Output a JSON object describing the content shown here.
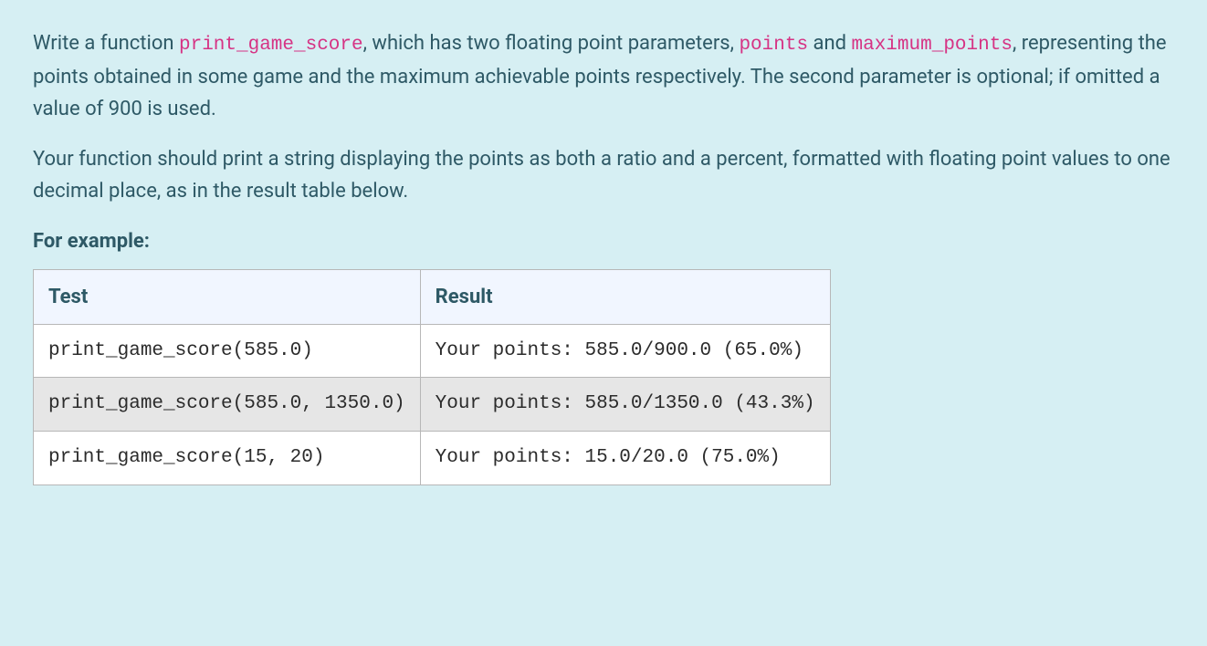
{
  "para1": {
    "t1": "Write a function ",
    "code1": "print_game_score",
    "t2": ", which has two floating point parameters, ",
    "code2": "points",
    "t3": " and ",
    "code3": "maximum_points",
    "t4": ", representing the points obtained in some game and the maximum achievable points respectively. The second parameter is optional; if omitted a value of 900 is used."
  },
  "para2": "Your function should print a string displaying the points as both a ratio and a percent, formatted with floating point values to one decimal place, as in the result table below.",
  "example_label": "For example:",
  "table": {
    "headers": {
      "test": "Test",
      "result": "Result"
    },
    "rows": [
      {
        "test": "print_game_score(585.0)",
        "result": "Your points: 585.0/900.0 (65.0%)"
      },
      {
        "test": "print_game_score(585.0, 1350.0)",
        "result": "Your points: 585.0/1350.0 (43.3%)"
      },
      {
        "test": "print_game_score(15, 20)",
        "result": "Your points: 15.0/20.0 (75.0%)"
      }
    ]
  }
}
